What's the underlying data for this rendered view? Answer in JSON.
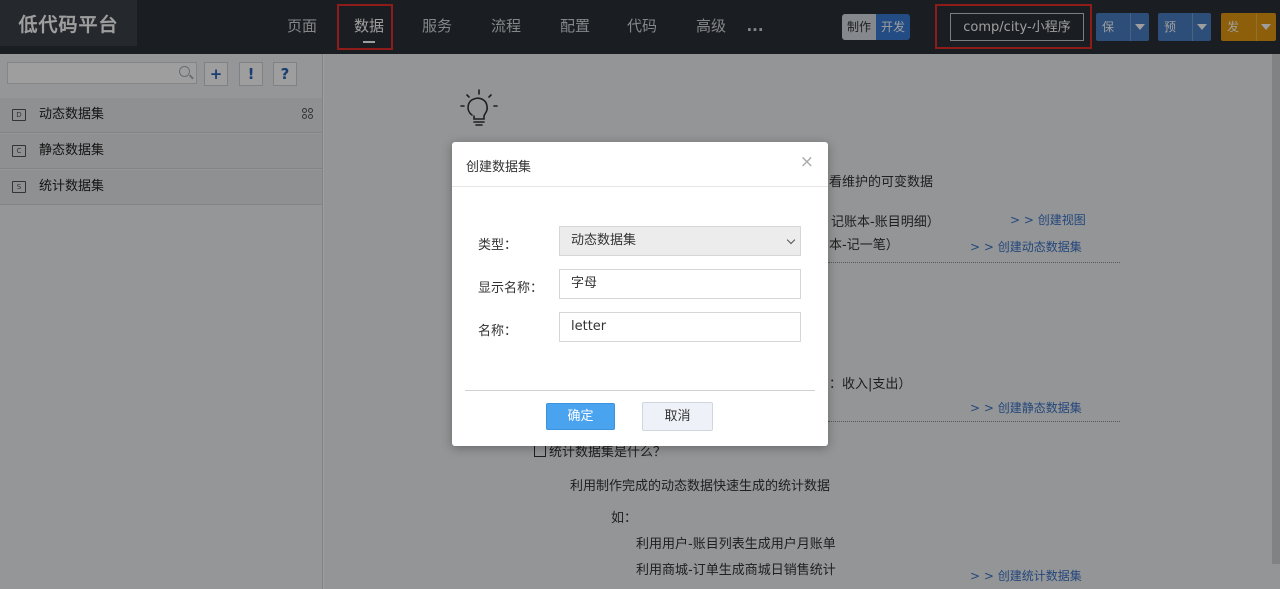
{
  "app": {
    "logo": "低代码平台"
  },
  "nav": {
    "items": [
      "页面",
      "数据",
      "服务",
      "流程",
      "配置",
      "代码",
      "高级",
      "..."
    ],
    "active": "数据"
  },
  "mode": {
    "make": "制作",
    "dev": "开发"
  },
  "project": {
    "name": "comp/city-小程序"
  },
  "actions": {
    "save": "保存",
    "preview": "预览",
    "publish": "发布"
  },
  "sidebar": {
    "search_placeholder": "",
    "tools": {
      "add": "+",
      "warn": "!",
      "help": "?"
    },
    "items": [
      {
        "label": "动态数据集",
        "icon": "D"
      },
      {
        "label": "静态数据集",
        "icon": "C"
      },
      {
        "label": "统计数据集",
        "icon": "S"
      }
    ]
  },
  "main": {
    "line_maintain": "看维护的可变数据",
    "line_ex1": "、记账本-账目明细）",
    "link_view": "> > 创建视图",
    "line_ex2": "本-记一笔）",
    "link_dynamic": "> > 创建动态数据集",
    "line_ex3": "：收入|支出）",
    "link_static": "> > 创建静态数据集",
    "stat_title": "统计数据集是什么？",
    "stat_desc": "利用制作完成的动态数据快速生成的统计数据",
    "such_as": "如：",
    "ex_a": "利用用户-账目列表生成用户月账单",
    "ex_b": "利用商城-订单生成商城日销售统计",
    "link_stat": "> > 创建统计数据集"
  },
  "dialog": {
    "title": "创建数据集",
    "close": "×",
    "type_label": "类型：",
    "type_value": "动态数据集",
    "display_label": "显示名称：",
    "display_value": "字母",
    "name_label": "名称：",
    "name_value": "letter",
    "ok": "确定",
    "cancel": "取消"
  }
}
